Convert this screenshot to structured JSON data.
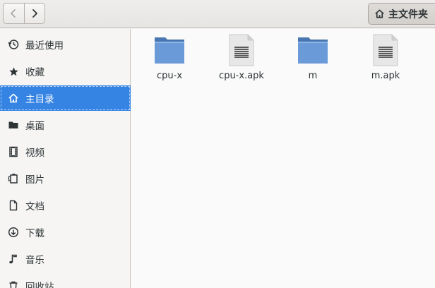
{
  "header": {
    "back_icon": "chevron-left-icon",
    "forward_icon": "chevron-right-icon",
    "path_label": "主文件夹",
    "path_icon": "home-icon"
  },
  "sidebar": {
    "items": [
      {
        "label": "最近使用",
        "icon": "recent-icon"
      },
      {
        "label": "收藏",
        "icon": "star-icon"
      },
      {
        "label": "主目录",
        "icon": "home-icon",
        "active": true
      },
      {
        "label": "桌面",
        "icon": "folder-icon"
      },
      {
        "label": "视频",
        "icon": "video-icon"
      },
      {
        "label": "图片",
        "icon": "image-icon"
      },
      {
        "label": "文档",
        "icon": "document-icon"
      },
      {
        "label": "下载",
        "icon": "download-icon"
      },
      {
        "label": "音乐",
        "icon": "music-icon"
      },
      {
        "label": "回收站",
        "icon": "trash-icon"
      }
    ]
  },
  "files": [
    {
      "name": "cpu-x",
      "type": "folder"
    },
    {
      "name": "cpu-x.apk",
      "type": "file"
    },
    {
      "name": "m",
      "type": "folder"
    },
    {
      "name": "m.apk",
      "type": "file"
    }
  ],
  "colors": {
    "accent": "#3584e4",
    "folder": "#6a9bd8",
    "folder_tab": "#4a76b1"
  }
}
